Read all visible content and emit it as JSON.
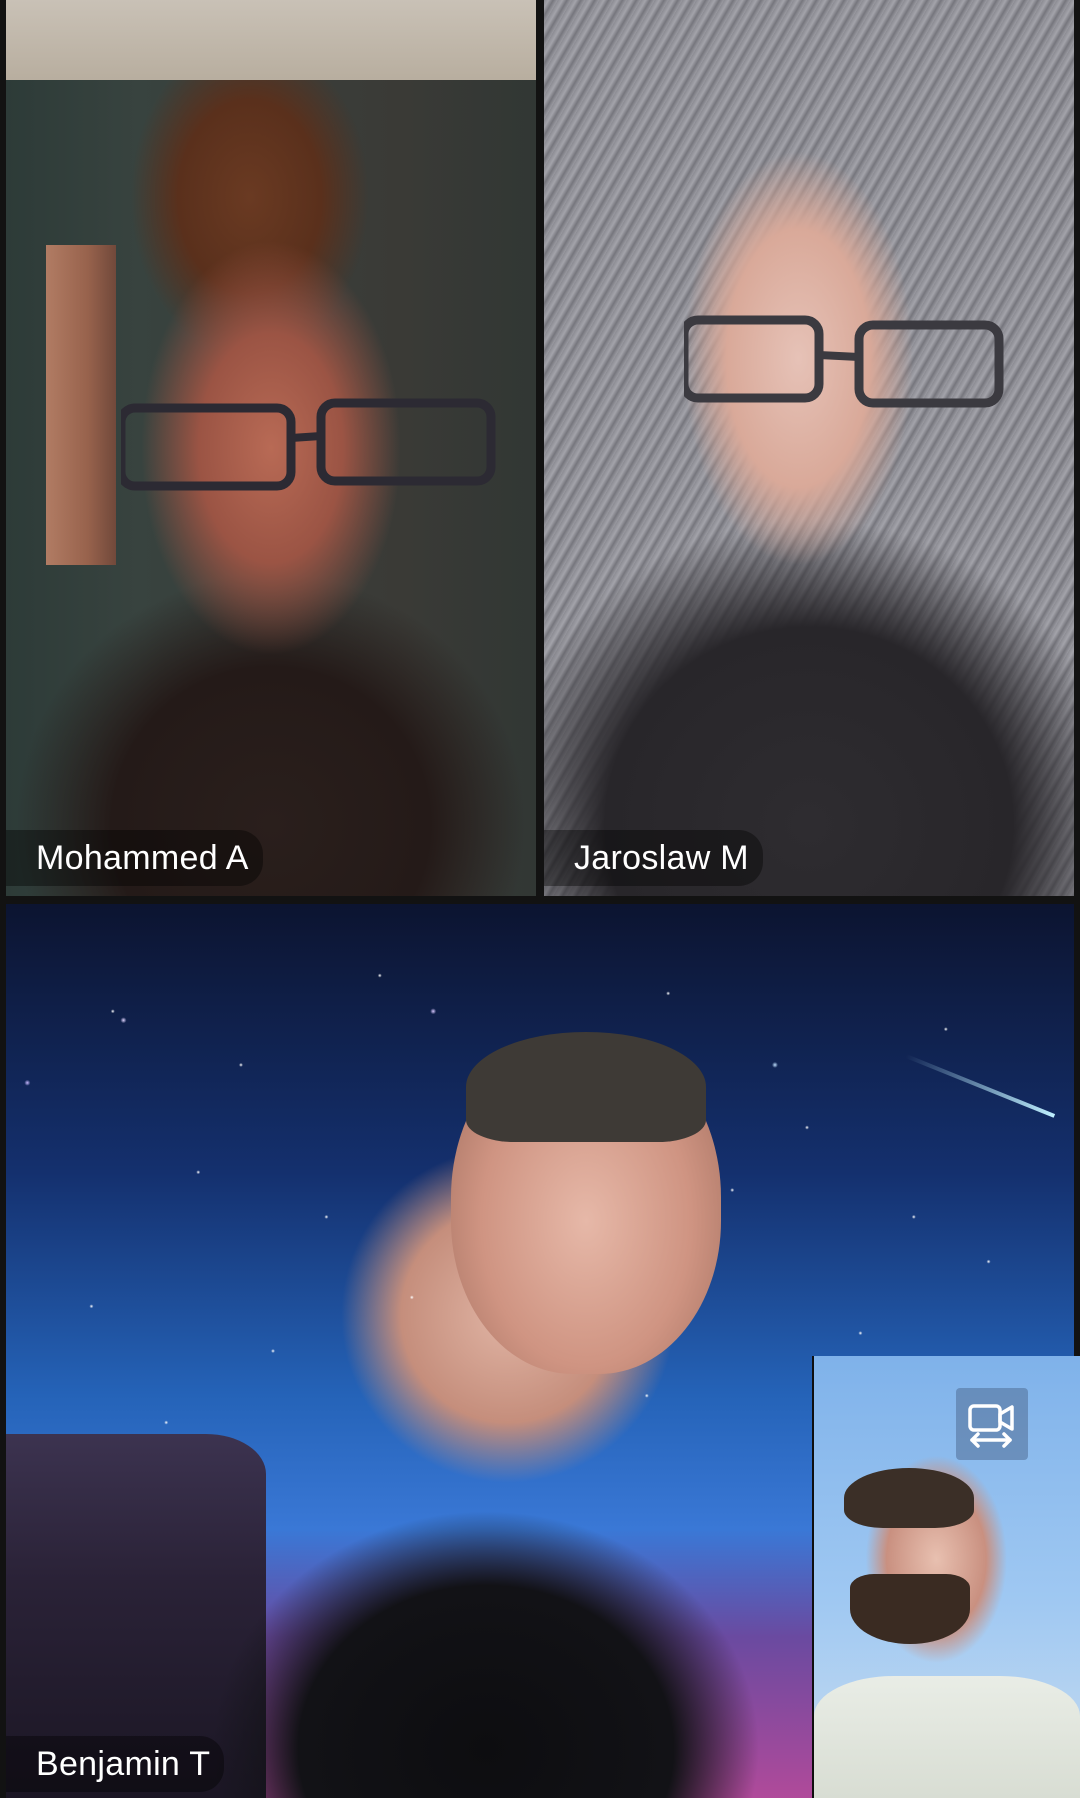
{
  "call": {
    "participants": [
      {
        "name": "Mohammed A"
      },
      {
        "name": "Jaroslaw M"
      },
      {
        "name": "Benjamin T"
      }
    ],
    "self_view": {
      "switch_camera_icon": "switch-camera-icon"
    }
  }
}
